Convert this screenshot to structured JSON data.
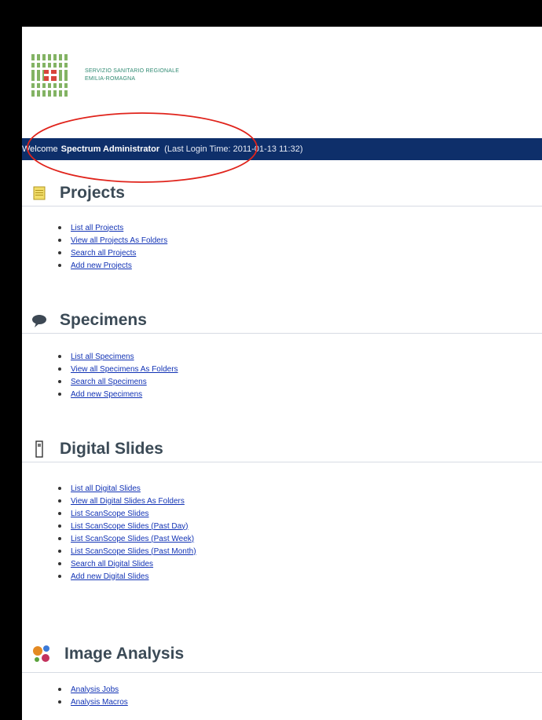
{
  "header": {
    "logo_line1": "SERVIZIO SANITARIO REGIONALE",
    "logo_line2": "EMILIA-ROMAGNA",
    "welcome_prefix": "Welcome",
    "user_name": "Spectrum Administrator",
    "last_login": "(Last Login Time: 2011-01-13 11:32)"
  },
  "colors": {
    "welcome_bar": "#0e2f6a",
    "link": "#1233b5",
    "annotation": "#e0231b"
  },
  "sections": [
    {
      "title": "Projects",
      "icon": "notepad-icon",
      "links": [
        "List all Projects",
        "View all Projects As Folders",
        "Search all Projects",
        "Add new Projects"
      ]
    },
    {
      "title": "Specimens",
      "icon": "speech-bubble-icon",
      "links": [
        "List all Specimens",
        "View all Specimens As Folders",
        "Search all Specimens",
        "Add new Specimens"
      ]
    },
    {
      "title": "Digital Slides",
      "icon": "slide-icon",
      "links": [
        "List all Digital Slides",
        "View all Digital Slides As Folders",
        "List ScanScope Slides",
        "List ScanScope Slides (Past Day)",
        "List ScanScope Slides (Past Week)",
        "List ScanScope Slides (Past Month)",
        "Search all Digital Slides",
        "Add new Digital Slides"
      ]
    },
    {
      "title": "Image Analysis",
      "icon": "molecule-icon",
      "links": [
        "Analysis Jobs",
        "Analysis Macros"
      ]
    }
  ]
}
